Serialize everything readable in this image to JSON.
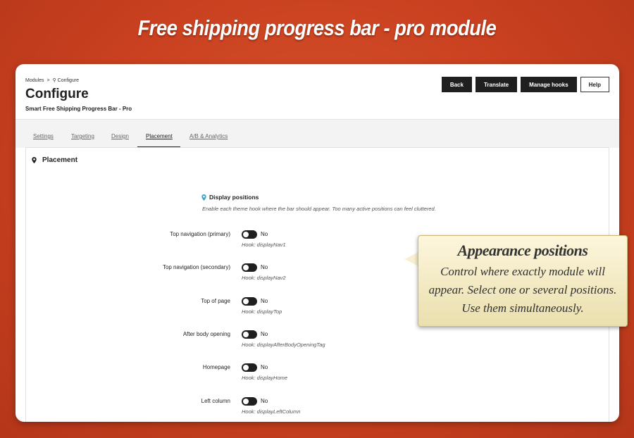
{
  "banner": {
    "title": "Free shipping progress bar - pro module"
  },
  "header": {
    "breadcrumb": {
      "root": "Modules",
      "separator": ">",
      "current": "Configure"
    },
    "title": "Configure",
    "subtitle": "Smart Free Shipping Progress Bar - Pro",
    "buttons": {
      "back": "Back",
      "translate": "Translate",
      "manage_hooks": "Manage hooks",
      "help": "Help"
    }
  },
  "tabs": [
    {
      "label": "Settings",
      "active": false
    },
    {
      "label": "Targeting",
      "active": false
    },
    {
      "label": "Design",
      "active": false
    },
    {
      "label": "Placement",
      "active": true
    },
    {
      "label": "A/B & Analytics",
      "active": false
    }
  ],
  "placement": {
    "section_title": "Placement",
    "display_positions_title": "Display positions",
    "display_positions_help": "Enable each theme hook where the bar should appear. Too many active positions can feel cluttered.",
    "rows": [
      {
        "label": "Top navigation (primary)",
        "state": "No",
        "hook": "Hook: displayNav1"
      },
      {
        "label": "Top navigation (secondary)",
        "state": "No",
        "hook": "Hook: displayNav2"
      },
      {
        "label": "Top of page",
        "state": "No",
        "hook": "Hook: displayTop"
      },
      {
        "label": "After body opening",
        "state": "No",
        "hook": "Hook: displayAfterBodyOpeningTag"
      },
      {
        "label": "Homepage",
        "state": "No",
        "hook": "Hook: displayHome"
      },
      {
        "label": "Left column",
        "state": "No",
        "hook": "Hook: displayLeftColumn"
      }
    ]
  },
  "callout": {
    "title": "Appearance positions",
    "body": "Control where exactly module will appear. Select one or several positions. Use them simultaneously."
  },
  "colors": {
    "background": "#c8401f",
    "accent_pin": "#3aa6c9",
    "dark_button": "#1f1f1f"
  }
}
